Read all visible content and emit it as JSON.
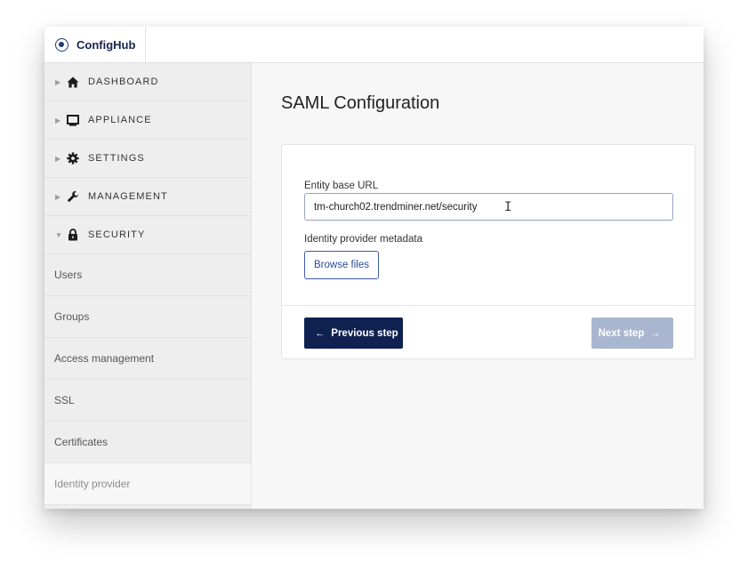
{
  "app": {
    "name": "ConfigHub"
  },
  "sidebar": {
    "sections": [
      {
        "label": "DASHBOARD",
        "icon": "home-icon",
        "expanded": false
      },
      {
        "label": "APPLIANCE",
        "icon": "monitor-icon",
        "expanded": false
      },
      {
        "label": "SETTINGS",
        "icon": "gear-icon",
        "expanded": false
      },
      {
        "label": "MANAGEMENT",
        "icon": "wrench-icon",
        "expanded": false
      },
      {
        "label": "SECURITY",
        "icon": "lock-icon",
        "expanded": true
      }
    ],
    "security_items": [
      {
        "label": "Users"
      },
      {
        "label": "Groups"
      },
      {
        "label": "Access management"
      },
      {
        "label": "SSL"
      },
      {
        "label": "Certificates"
      },
      {
        "label": "Identity provider",
        "active": true
      }
    ]
  },
  "main": {
    "title": "SAML Configuration",
    "entity_label": "Entity base URL",
    "entity_value": "tm-church02.trendminer.net/security",
    "metadata_label": "Identity provider metadata",
    "browse_label": "Browse files",
    "prev_label": "Previous step",
    "next_label": "Next step"
  },
  "colors": {
    "primary": "#0f2150",
    "disabled": "#a9b6cf",
    "link": "#2b4a9c"
  }
}
